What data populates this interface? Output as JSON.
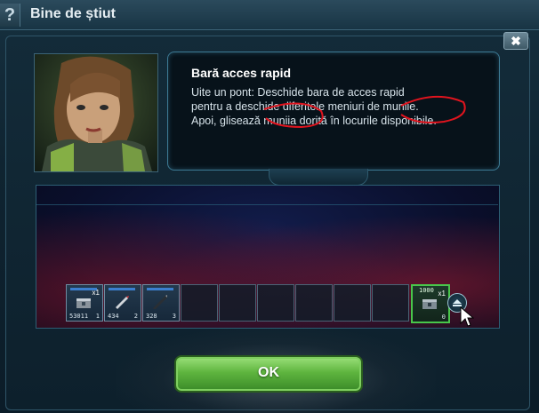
{
  "window": {
    "title": "Bine de știut",
    "help_icon_label": "?"
  },
  "close_button": {
    "label": "✖"
  },
  "tip": {
    "title": "Bară acces rapid",
    "lines": [
      "Uite un pont: Deschide bara de acces rapid",
      "pentru a deschide diferitele meniuri de muniie.",
      "Apoi, glisează muniia dorită în locurile disponibile."
    ]
  },
  "quickbar": {
    "slots": [
      {
        "filled": true,
        "qty": "53011",
        "num": "1",
        "mult": "x1",
        "item": "ammo-crate-icon"
      },
      {
        "filled": true,
        "qty": "434",
        "num": "2",
        "mult": "",
        "item": "rocket-icon"
      },
      {
        "filled": true,
        "qty": "328",
        "num": "3",
        "mult": "",
        "item": "missile-icon"
      },
      {
        "filled": false
      },
      {
        "filled": false
      },
      {
        "filled": false
      },
      {
        "filled": false
      },
      {
        "filled": false
      },
      {
        "filled": false
      }
    ],
    "special_slot": {
      "top": "1000",
      "mult": "x1",
      "num": "0",
      "item": "crate-green-icon"
    }
  },
  "ok_button": {
    "label": "OK"
  },
  "colors": {
    "accent_green": "#49c64b",
    "panel_border": "#3d7a94",
    "annotation_red": "#e0141e"
  }
}
